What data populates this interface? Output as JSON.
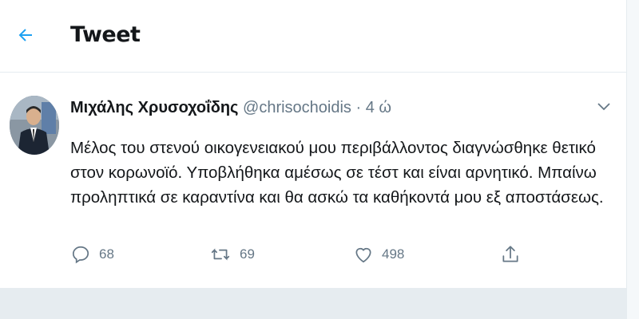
{
  "header": {
    "title": "Tweet",
    "back_icon": "arrow-left-icon"
  },
  "tweet": {
    "author_name": "Μιχάλης Χρυσοχοΐδης",
    "handle": "@chrisochoidis",
    "separator": "·",
    "time": "4 ώ",
    "text": "Μέλος του στενού οικογενειακού μου περιβάλλοντος διαγνώσθηκε θετικό στον κορωνοϊό. Υποβλήθηκα αμέσως σε τέστ και είναι αρνητικό. Μπαίνω προληπτικά σε καραντίνα και θα ασκώ τα καθήκοντά μου εξ αποστάσεως.",
    "more_icon": "chevron-down-icon"
  },
  "actions": {
    "reply_count": "68",
    "retweet_count": "69",
    "like_count": "498"
  },
  "colors": {
    "accent": "#1da1f2",
    "text": "#14171a",
    "secondary": "#657786",
    "divider": "#e6ecf0"
  }
}
